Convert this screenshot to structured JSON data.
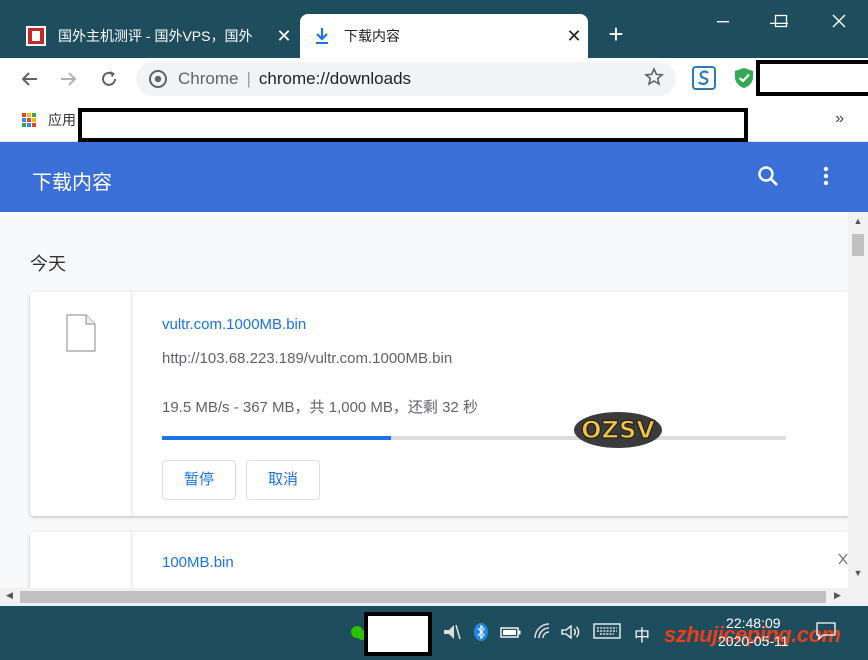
{
  "tabs": [
    {
      "title": "国外主机测评 - 国外VPS，国外",
      "close": "✕"
    },
    {
      "title": "下载内容",
      "close": "✕"
    }
  ],
  "new_tab": "+",
  "window_controls": {
    "minimize": "—",
    "maximize": "☐",
    "close": "✕"
  },
  "omnibox": {
    "scheme_label": "Chrome",
    "separator": "|",
    "url": "chrome://downloads"
  },
  "bookmarks": {
    "apps_label": "应用",
    "overflow": "»"
  },
  "downloads": {
    "header_title": "下载内容",
    "section_label": "今天",
    "items": [
      {
        "name": "vultr.com.1000MB.bin",
        "url": "http://103.68.223.189/vultr.com.1000MB.bin",
        "status": "19.5 MB/s - 367 MB，共 1,000 MB，还剩 32 秒",
        "progress": 0.367,
        "pause_label": "暂停",
        "cancel_label": "取消"
      },
      {
        "name": "100MB.bin"
      }
    ]
  },
  "overlay_logo_text": "OZSV",
  "taskbar": {
    "ime": "中",
    "time": "22:48:09",
    "date": "2020-05-11",
    "watermark": "szhujiceping.com"
  },
  "colors": {
    "accent": "#1a73e8",
    "header": "#3b6fd8",
    "titlebar": "#1e4d5e"
  }
}
